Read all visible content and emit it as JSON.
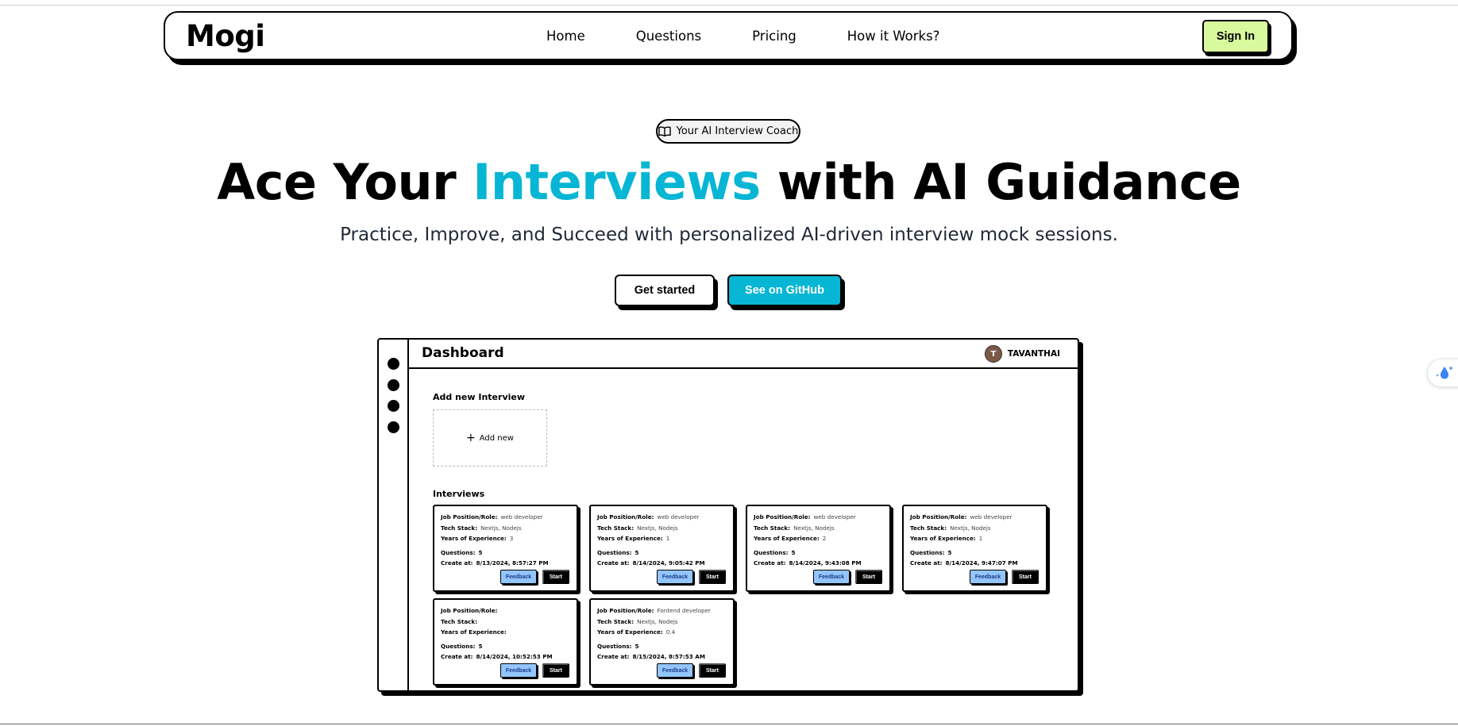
{
  "nav": {
    "logo": "Mogi",
    "links": [
      "Home",
      "Questions",
      "Pricing",
      "How it Works?"
    ],
    "signin": "Sign In"
  },
  "hero": {
    "badge": "Your AI Interview Coach",
    "badge_icon": "book-open-icon",
    "title_pre": "Ace Your ",
    "title_accent": "Interviews",
    "title_post": " with AI Guidance",
    "subtitle": "Practice, Improve, and Succeed with personalized AI-driven interview mock sessions.",
    "get_started": "Get started",
    "github": "See on GitHub"
  },
  "colors": {
    "accent": "#06b6d4",
    "signin_bg": "#d9f99d",
    "feedback_bg": "#93c5fd"
  },
  "dashboard": {
    "title": "Dashboard",
    "user_initial": "T",
    "user_name": "TAVANTHAI",
    "add_label": "Add new Interview",
    "add_button": "Add new",
    "interviews_label": "Interviews",
    "field_labels": {
      "role": "Job Position/Role:",
      "stack": "Tech Stack:",
      "exp": "Years of Experience:",
      "questions": "Questions:",
      "created": "Create at:"
    },
    "feedback_label": "Feedback",
    "start_label": "Start",
    "interviews": [
      {
        "role": "web developer",
        "stack": "Nextjs, Nodejs",
        "exp": "3",
        "questions": "5",
        "created": "8/13/2024, 8:57:27 PM"
      },
      {
        "role": "web developer",
        "stack": "Nextjs, Nodejs",
        "exp": "1",
        "questions": "5",
        "created": "8/14/2024, 9:05:42 PM"
      },
      {
        "role": "web developer",
        "stack": "Nextjs, Nodejs",
        "exp": "2",
        "questions": "5",
        "created": "8/14/2024, 9:43:08 PM"
      },
      {
        "role": "web developer",
        "stack": "Nextjs, Nodejs",
        "exp": "1",
        "questions": "5",
        "created": "8/14/2024, 9:47:07 PM"
      },
      {
        "role": "",
        "stack": "",
        "exp": "",
        "questions": "5",
        "created": "8/14/2024, 10:52:53 PM"
      },
      {
        "role": "Fontend developer",
        "stack": "Nextjs, Nodejs",
        "exp": "0.4",
        "questions": "5",
        "created": "8/15/2024, 8:57:53 AM"
      }
    ]
  }
}
